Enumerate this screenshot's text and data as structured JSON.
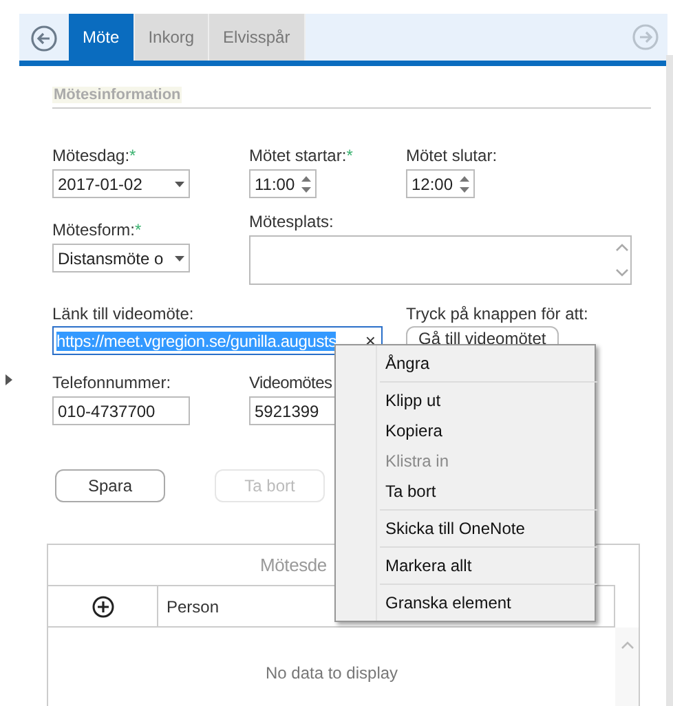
{
  "tabs": [
    {
      "label": "Möte",
      "selected": true
    },
    {
      "label": "Inkorg",
      "selected": false
    },
    {
      "label": "Elvisspår",
      "selected": false
    }
  ],
  "section_title": "Mötesinformation",
  "meeting_date": {
    "label": "Mötesdag:",
    "mark": "*",
    "value": "2017-01-02"
  },
  "start_time": {
    "label": "Mötet startar:",
    "mark": "*",
    "value": "11:00"
  },
  "end_time": {
    "label": "Mötet slutar:",
    "value": "12:00"
  },
  "meeting_form": {
    "label": "Mötesform:",
    "mark": "*",
    "value": "Distansmöte o"
  },
  "meeting_place": {
    "label": "Mötesplats:"
  },
  "video_link": {
    "label": "Länk till videomöte:",
    "value": "https://meet.vgregion.se/gunilla.augusts",
    "selected": true,
    "clear": "×"
  },
  "video_action": {
    "label": "Tryck på knappen för att:",
    "button": "Gå till videomötet"
  },
  "phone": {
    "label": "Telefonnummer:",
    "value": "010-4737700"
  },
  "video_id": {
    "label": "Videomötes",
    "value": "5921399"
  },
  "buttons": [
    {
      "label": "Spara",
      "disabled": false
    },
    {
      "label": "Ta bort",
      "disabled": true
    }
  ],
  "table": {
    "title": "Mötesde",
    "columns": [
      {
        "kind": "add"
      },
      {
        "kind": "text",
        "label": "Person"
      }
    ],
    "empty_text": "No data to display"
  },
  "context_menu": {
    "groups": [
      {
        "items": [
          {
            "label": "Ångra",
            "disabled": false
          }
        ]
      },
      {
        "items": [
          {
            "label": "Klipp ut",
            "disabled": false
          },
          {
            "label": "Kopiera",
            "disabled": false
          },
          {
            "label": "Klistra in",
            "disabled": true
          },
          {
            "label": "Ta bort",
            "disabled": false
          }
        ]
      },
      {
        "items": [
          {
            "label": "Skicka till OneNote",
            "disabled": false
          }
        ]
      },
      {
        "items": [
          {
            "label": "Markera allt",
            "disabled": false
          }
        ]
      },
      {
        "items": [
          {
            "label": "Granska element",
            "disabled": false
          }
        ]
      }
    ]
  }
}
